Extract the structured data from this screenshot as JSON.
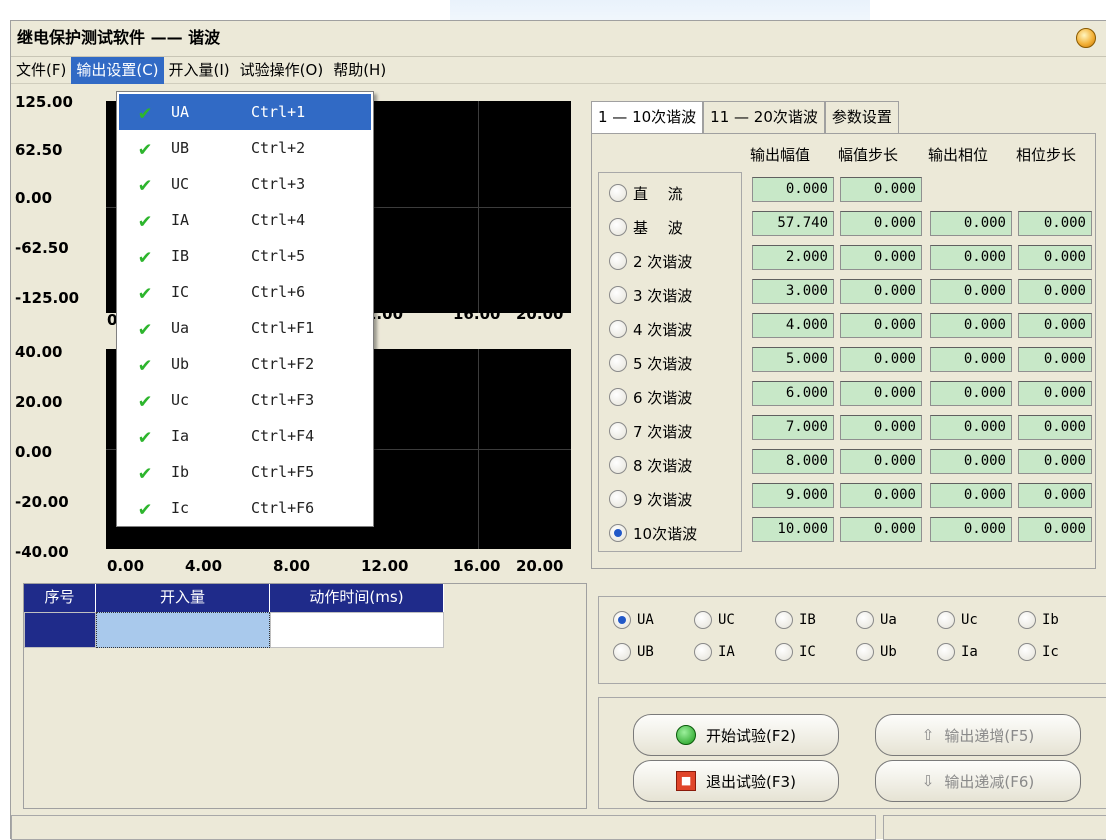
{
  "title": "继电保护测试软件 —— 谐波",
  "menu": {
    "file": "文件(F)",
    "output": "输出设置(C)",
    "binary": "开入量(I)",
    "test": "试验操作(O)",
    "help": "帮助(H)"
  },
  "dropdown": [
    {
      "name": "UA",
      "key": "Ctrl+1"
    },
    {
      "name": "UB",
      "key": "Ctrl+2"
    },
    {
      "name": "UC",
      "key": "Ctrl+3"
    },
    {
      "name": "IA",
      "key": "Ctrl+4"
    },
    {
      "name": "IB",
      "key": "Ctrl+5"
    },
    {
      "name": "IC",
      "key": "Ctrl+6"
    },
    {
      "name": "Ua",
      "key": "Ctrl+F1"
    },
    {
      "name": "Ub",
      "key": "Ctrl+F2"
    },
    {
      "name": "Uc",
      "key": "Ctrl+F3"
    },
    {
      "name": "Ia",
      "key": "Ctrl+F4"
    },
    {
      "name": "Ib",
      "key": "Ctrl+F5"
    },
    {
      "name": "Ic",
      "key": "Ctrl+F6"
    }
  ],
  "chart1": {
    "yticks": [
      "125.00",
      "62.50",
      "0.00",
      "-62.50",
      "-125.00"
    ],
    "xtick_first": "0",
    "xticks_right": [
      "2.00",
      "16.00",
      "20.00"
    ]
  },
  "chart2": {
    "yticks": [
      "40.00",
      "20.00",
      "0.00",
      "-20.00",
      "-40.00"
    ],
    "xticks": [
      "0.00",
      "4.00",
      "8.00",
      "12.00",
      "16.00",
      "20.00"
    ]
  },
  "tabs": [
    "1 — 10次谐波",
    "11 — 20次谐波",
    "参数设置"
  ],
  "headers": [
    "输出幅值",
    "幅值步长",
    "输出相位",
    "相位步长"
  ],
  "rows": [
    {
      "label": "直　 流",
      "amp": "0.000",
      "amp_step": "0.000"
    },
    {
      "label": "基　 波",
      "amp": "57.740",
      "amp_step": "0.000",
      "phase": "0.000",
      "phase_step": "0.000"
    },
    {
      "label": "2 次谐波",
      "amp": "2.000",
      "amp_step": "0.000",
      "phase": "0.000",
      "phase_step": "0.000"
    },
    {
      "label": "3 次谐波",
      "amp": "3.000",
      "amp_step": "0.000",
      "phase": "0.000",
      "phase_step": "0.000"
    },
    {
      "label": "4 次谐波",
      "amp": "4.000",
      "amp_step": "0.000",
      "phase": "0.000",
      "phase_step": "0.000"
    },
    {
      "label": "5 次谐波",
      "amp": "5.000",
      "amp_step": "0.000",
      "phase": "0.000",
      "phase_step": "0.000"
    },
    {
      "label": "6 次谐波",
      "amp": "6.000",
      "amp_step": "0.000",
      "phase": "0.000",
      "phase_step": "0.000"
    },
    {
      "label": "7 次谐波",
      "amp": "7.000",
      "amp_step": "0.000",
      "phase": "0.000",
      "phase_step": "0.000"
    },
    {
      "label": "8 次谐波",
      "amp": "8.000",
      "amp_step": "0.000",
      "phase": "0.000",
      "phase_step": "0.000"
    },
    {
      "label": "9 次谐波",
      "amp": "9.000",
      "amp_step": "0.000",
      "phase": "0.000",
      "phase_step": "0.000"
    },
    {
      "label": "10次谐波",
      "amp": "10.000",
      "amp_step": "0.000",
      "phase": "0.000",
      "phase_step": "0.000"
    }
  ],
  "selected_harmonic": "10次谐波",
  "table": {
    "cols": [
      "序号",
      "开入量",
      "动作时间(ms)"
    ]
  },
  "channels": [
    "UA",
    "UC",
    "IB",
    "Ua",
    "Uc",
    "Ib",
    "UB",
    "IA",
    "IC",
    "Ub",
    "Ia",
    "Ic"
  ],
  "selected_channel": "UA",
  "buttons": {
    "start": "开始试验(F2)",
    "stop": "退出试验(F3)",
    "inc": "输出递增(F5)",
    "dec": "输出递减(F6)"
  }
}
